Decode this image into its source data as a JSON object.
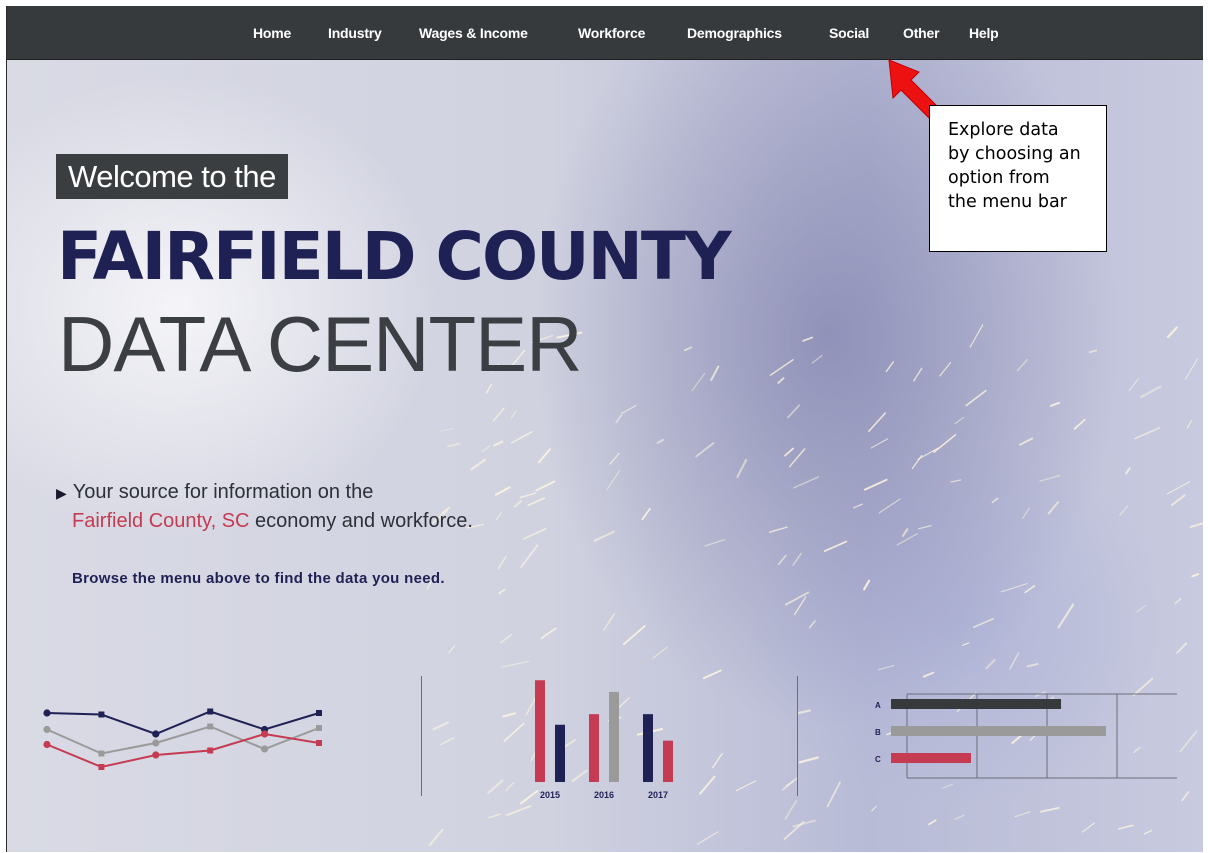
{
  "nav": {
    "items": [
      "Home",
      "Industry",
      "Wages & Income",
      "Workforce",
      "Demographics",
      "Social",
      "Other",
      "Help"
    ]
  },
  "hero": {
    "welcome": "Welcome to the",
    "title": "FAIRFIELD COUNTY",
    "subtitle": "DATA CENTER",
    "tagline_line1": "Your source for information on the",
    "tagline_place": "Fairfield County, SC",
    "tagline_rest": " economy and workforce.",
    "browse": "Browse the menu above to find the data you need."
  },
  "callout": {
    "lines": [
      "Explore data",
      "by choosing an",
      "option from",
      "the menu bar"
    ]
  },
  "colors": {
    "navy": "#1f2155",
    "red": "#c43b52",
    "gray": "#9a9a9a",
    "dark": "#363a3c"
  },
  "icons": {
    "tagline_bullet": "triangle-right-icon",
    "callout_pointer": "red-arrow-icon"
  },
  "chart_data": [
    {
      "type": "line",
      "x": [
        1,
        2,
        3,
        4,
        5,
        6
      ],
      "series": [
        {
          "values": [
            8.6,
            8.5,
            7.2,
            8.7,
            7.5,
            8.6
          ]
        },
        {
          "values": [
            7.5,
            5.9,
            6.6,
            7.7,
            6.2,
            7.6
          ]
        },
        {
          "values": [
            6.5,
            5.0,
            5.8,
            6.1,
            7.2,
            6.6
          ]
        }
      ],
      "ylim": [
        4,
        10
      ]
    },
    {
      "type": "bar",
      "categories": [
        "2015",
        "2016",
        "2017"
      ],
      "series": [
        {
          "values": [
            96,
            64,
            0
          ]
        },
        {
          "values": [
            54,
            0,
            0
          ]
        }
      ],
      "bars": [
        {
          "category": "2015",
          "color": "red",
          "value": 96
        },
        {
          "category": "2015",
          "color": "navy",
          "value": 54
        },
        {
          "category": "2016",
          "color": "red",
          "value": 64
        },
        {
          "category": "2016",
          "color": "gray",
          "value": 85
        },
        {
          "category": "2017",
          "color": "navy",
          "value": 64
        },
        {
          "category": "2017",
          "color": "red",
          "value": 39
        }
      ],
      "ylim": [
        0,
        100
      ]
    },
    {
      "type": "bar",
      "orientation": "horizontal",
      "categories": [
        "A",
        "B",
        "C"
      ],
      "values": [
        68,
        86,
        32
      ],
      "bar_colors": [
        "dark",
        "gray",
        "red"
      ],
      "xlim": [
        0,
        100
      ]
    }
  ]
}
